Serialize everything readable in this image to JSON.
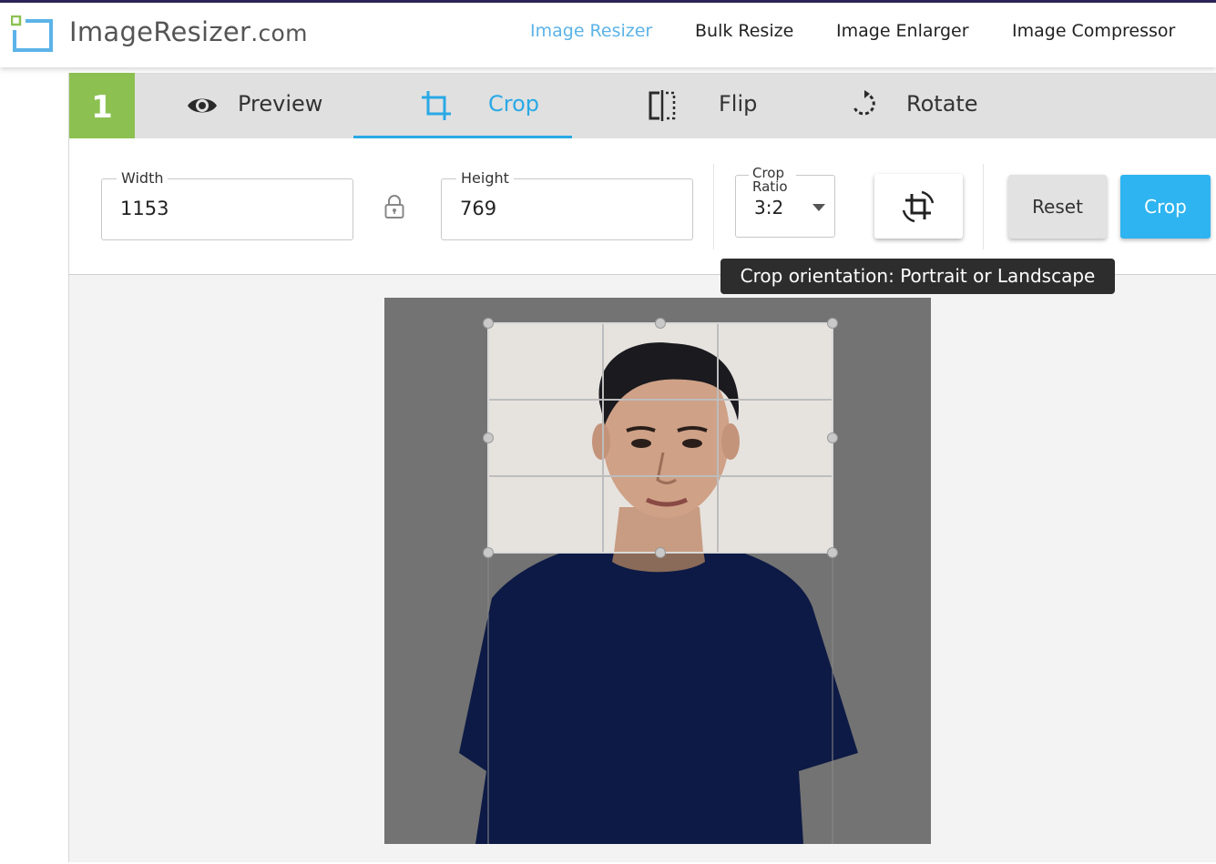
{
  "brand": {
    "name": "ImageResizer",
    "domain": ".com",
    "logo_icon": "resize-square-icon"
  },
  "nav": [
    {
      "label": "Image Resizer",
      "active": true
    },
    {
      "label": "Bulk Resize",
      "active": false
    },
    {
      "label": "Image Enlarger",
      "active": false
    },
    {
      "label": "Image Compressor",
      "active": false
    }
  ],
  "step": {
    "number": "1"
  },
  "tabs": [
    {
      "label": "Preview",
      "icon": "eye-icon"
    },
    {
      "label": "Crop",
      "icon": "crop-icon",
      "active": true
    },
    {
      "label": "Flip",
      "icon": "flip-icon"
    },
    {
      "label": "Rotate",
      "icon": "rotate-icon"
    }
  ],
  "crop_controls": {
    "width_label": "Width",
    "width_value": "1153",
    "height_label": "Height",
    "height_value": "769",
    "lock_icon": "lock-icon",
    "ratio_label": "Crop Ratio",
    "ratio_value": "3:2",
    "orientation_icon": "crop-rotate-icon",
    "reset_label": "Reset",
    "crop_label": "Crop"
  },
  "tooltip": {
    "text": "Crop orientation: Portrait or Landscape"
  },
  "colors": {
    "accent": "#29a9e6",
    "step_green": "#8cc152",
    "nav_active": "#5bb3e8"
  }
}
